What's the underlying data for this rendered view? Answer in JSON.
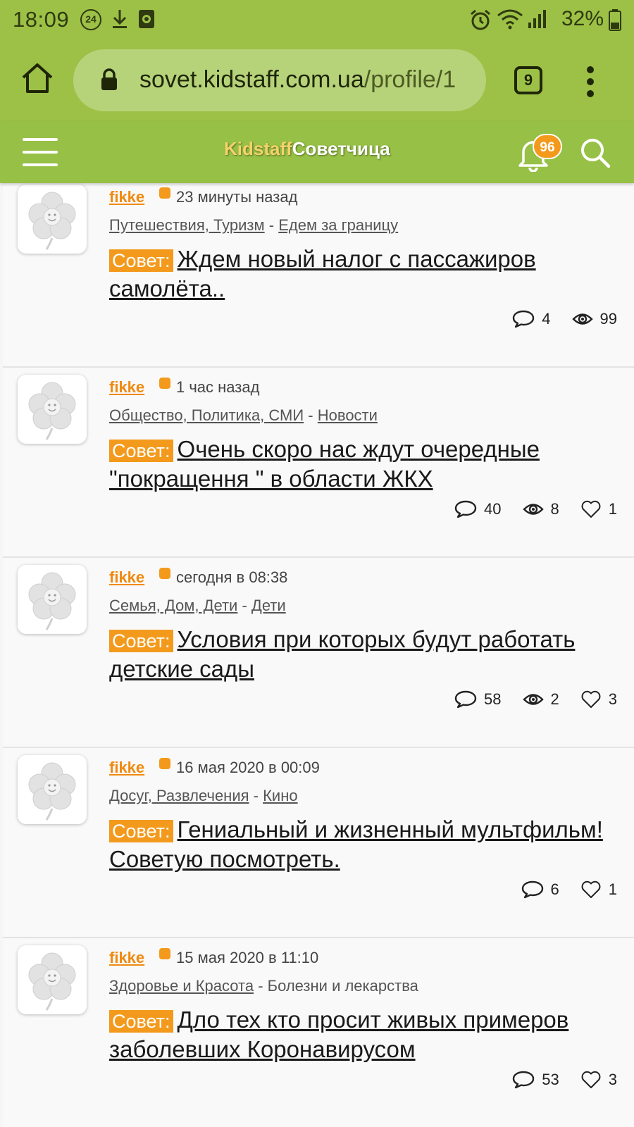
{
  "status_bar": {
    "time": "18:09",
    "badge": "24",
    "battery": "32%"
  },
  "browser": {
    "url_domain": "sovet.kidstaff.com.ua",
    "url_path": "/profile/1",
    "tab_count": "9"
  },
  "app_bar": {
    "logo_part1": "Kidstaff",
    "logo_part2": "Советчица",
    "notifications": "96"
  },
  "posts": [
    {
      "author": "fikke",
      "time": "23 минуты назад",
      "category": "Путешествия, Туризм",
      "subcategory": "Едем за границу",
      "tag": "Совет:",
      "title": "Ждем новый налог с пассажиров самолёта..",
      "comments": "4",
      "views": "99"
    },
    {
      "author": "fikke",
      "time": "1 час назад",
      "category": "Общество, Политика, СМИ",
      "subcategory": "Новости",
      "tag": "Совет:",
      "title": "Очень скоро нас ждут очередные \"покращення \" в области ЖКХ",
      "comments": "40",
      "views": "8",
      "likes": "1"
    },
    {
      "author": "fikke",
      "time": "сегодня в 08:38",
      "category": "Семья, Дом, Дети",
      "subcategory": "Дети",
      "tag": "Совет:",
      "title": "Условия при которых будут работать детские сады",
      "comments": "58",
      "views": "2",
      "likes": "3"
    },
    {
      "author": "fikke",
      "time": "16 мая 2020 в 00:09",
      "category": "Досуг, Развлечения",
      "subcategory": "Кино",
      "tag": "Совет:",
      "title": "Гениальный и жизненный мультфильм! Советую посмотреть.",
      "comments": "6",
      "likes": "1"
    },
    {
      "author": "fikke",
      "time": "15 мая 2020 в 11:10",
      "category": "Здоровье и Красота",
      "subcategory": "Болезни и лекарства",
      "tag": "Совет:",
      "title": "Дло тех кто просит живых примеров заболевших Коронавирусом",
      "comments": "53",
      "likes": "3"
    }
  ]
}
